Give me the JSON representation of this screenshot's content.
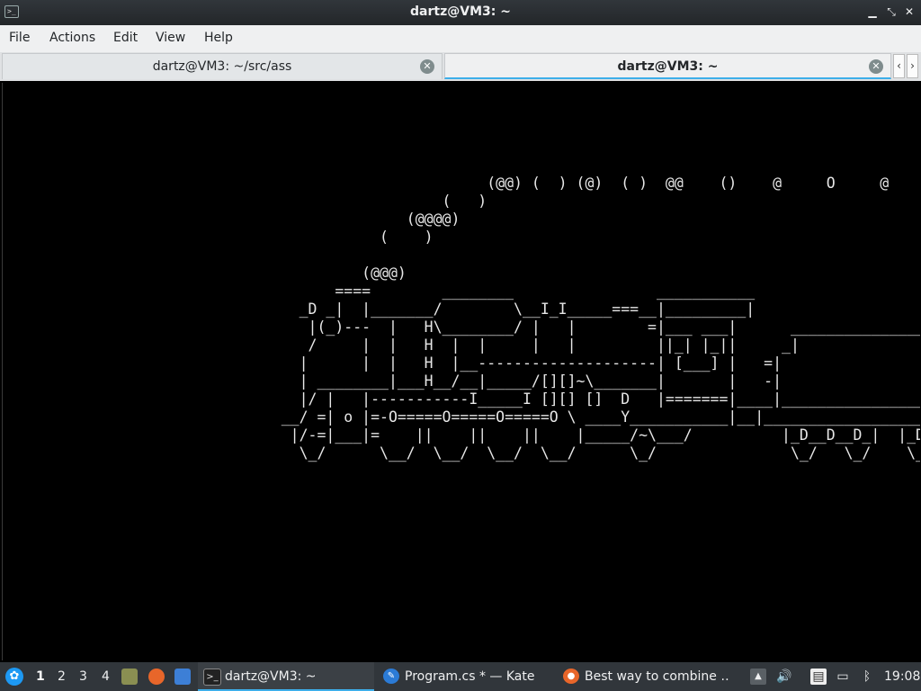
{
  "window": {
    "title": "dartz@VM3: ~"
  },
  "menu": {
    "items": [
      "File",
      "Actions",
      "Edit",
      "View",
      "Help"
    ]
  },
  "tabs": [
    {
      "label": "dartz@VM3: ~/src/ass",
      "active": false
    },
    {
      "label": "dartz@VM3: ~",
      "active": true
    }
  ],
  "terminal": {
    "output": "                           (@@) (  ) (@)  ( )  @@    ()    @     O     @\n                      (   )\n                  (@@@@)\n               (    )\n\n             (@@@)\n          ====        ________                ___________\n      _D _|  |_______/        \\__I_I_____===__|_________|\n       |(_)---  |   H\\________/ |   |        =|___ ___|      _________________\n       /     |  |   H  |  |     |   |         ||_| |_||     _|\n      |      |  |   H  |__--------------------| [___] |   =|\n      | ________|___H__/__|_____/[][]~\\_______|       |   -|\n      |/ |   |-----------I_____I [][] []  D   |=======|____|________________\n    __/ =| o |=-O=====O=====O=====O \\ ____Y___________|__|__________________\n     |/-=|___|=    ||    ||    ||    |_____/~\\___/          |_D__D__D_|  |_D\n      \\_/      \\__/  \\__/  \\__/  \\__/      \\_/               \\_/   \\_/    \\_"
  },
  "taskbar": {
    "desktops": [
      "1",
      "2",
      "3",
      "4"
    ],
    "tasks": [
      {
        "label": "dartz@VM3: ~",
        "active": true
      },
      {
        "label": "Program.cs * — Kate",
        "active": false
      },
      {
        "label": "Best way to combine …",
        "active": false
      }
    ],
    "clock": "19:08"
  },
  "colors": {
    "accent": "#3daee9",
    "titlebar": "#31363b",
    "terminal_bg": "#000000",
    "terminal_fg": "#e6e6e6"
  }
}
